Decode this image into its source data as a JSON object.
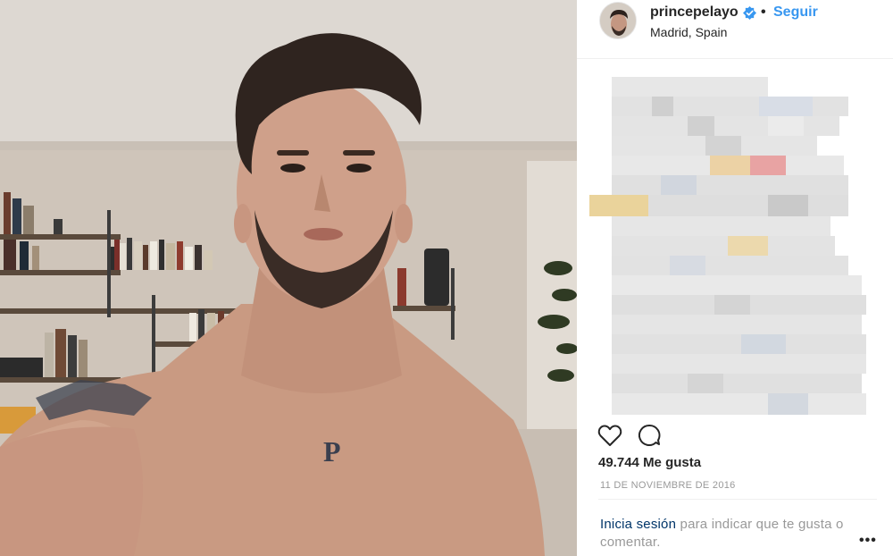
{
  "post": {
    "username": "princepelayo",
    "separator": "•",
    "follow_label": "Seguir",
    "location": "Madrid, Spain",
    "likes_count": "49.744",
    "likes_label": "Me gusta",
    "date": "11 DE NOVIEMBRE DE 2016",
    "login_link": "Inicia sesión",
    "login_rest": " para indicar que te gusta o comentar.",
    "more": "•••",
    "chest_tattoo": "P"
  },
  "icons": {
    "verified": "verified-badge-icon",
    "like": "heart-icon",
    "comment": "comment-icon",
    "more": "more-options-icon"
  },
  "colors": {
    "follow": "#3897f0",
    "link": "#003569",
    "verified": "#3897f0",
    "muted": "#999999"
  }
}
